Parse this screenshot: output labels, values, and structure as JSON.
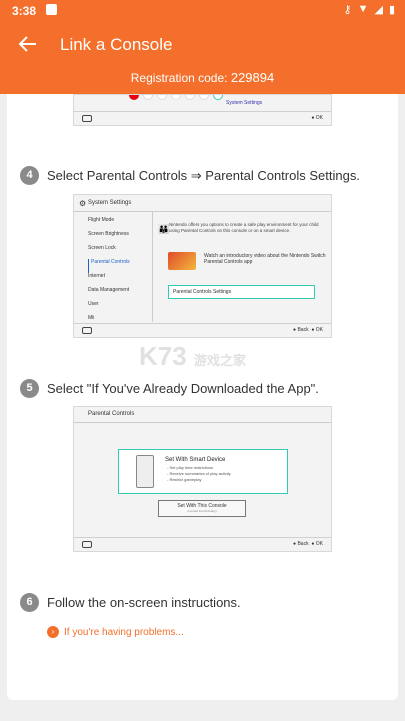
{
  "status_bar": {
    "time": "3:38",
    "icons": [
      "key-icon",
      "wifi-icon",
      "signal-icon",
      "battery-icon"
    ]
  },
  "app_bar": {
    "title": "Link a Console",
    "registration_label": "Registration code:",
    "registration_code": "229894"
  },
  "colors": {
    "accent": "#f36f2b",
    "highlight": "#33c9b3",
    "step_badge": "#8a8a8a"
  },
  "shot1": {
    "label": "System Settings",
    "footer_ok": "OK"
  },
  "steps": [
    {
      "number": "4",
      "text": "Select Parental Controls ⇒ Parental Controls Settings."
    },
    {
      "number": "5",
      "text": "Select \"If You've Already Downloaded the App\"."
    },
    {
      "number": "6",
      "text": "Follow the on-screen instructions."
    }
  ],
  "shot2": {
    "header": "System Settings",
    "menu": [
      "Flight Mode",
      "Screen Brightness",
      "Screen Lock",
      "Parental Controls",
      "Internet",
      "Data Management",
      "User",
      "Mii"
    ],
    "description": "Nintendo offers you options to create a safe play environment for your child using Parental Controls on this console or on a smart device.",
    "video_text": "Watch an introductory video about the Nintendo Switch Parental Controls app",
    "settings_button": "Parental Controls Settings",
    "footer_back": "Back",
    "footer_ok": "OK"
  },
  "shot3": {
    "header": "Parental Controls",
    "smart_title": "Set With Smart Device",
    "smart_items": [
      "- Set play time restrictions",
      "- Receive summaries of play activity",
      "- Restrict gameplay"
    ],
    "console_button": "Set With This Console",
    "console_sub": "(Limited Functionality)",
    "footer_back": "Back",
    "footer_ok": "OK"
  },
  "watermark": {
    "mark": "K73",
    "text": "游戏之家"
  },
  "help_link": "If you're having problems..."
}
